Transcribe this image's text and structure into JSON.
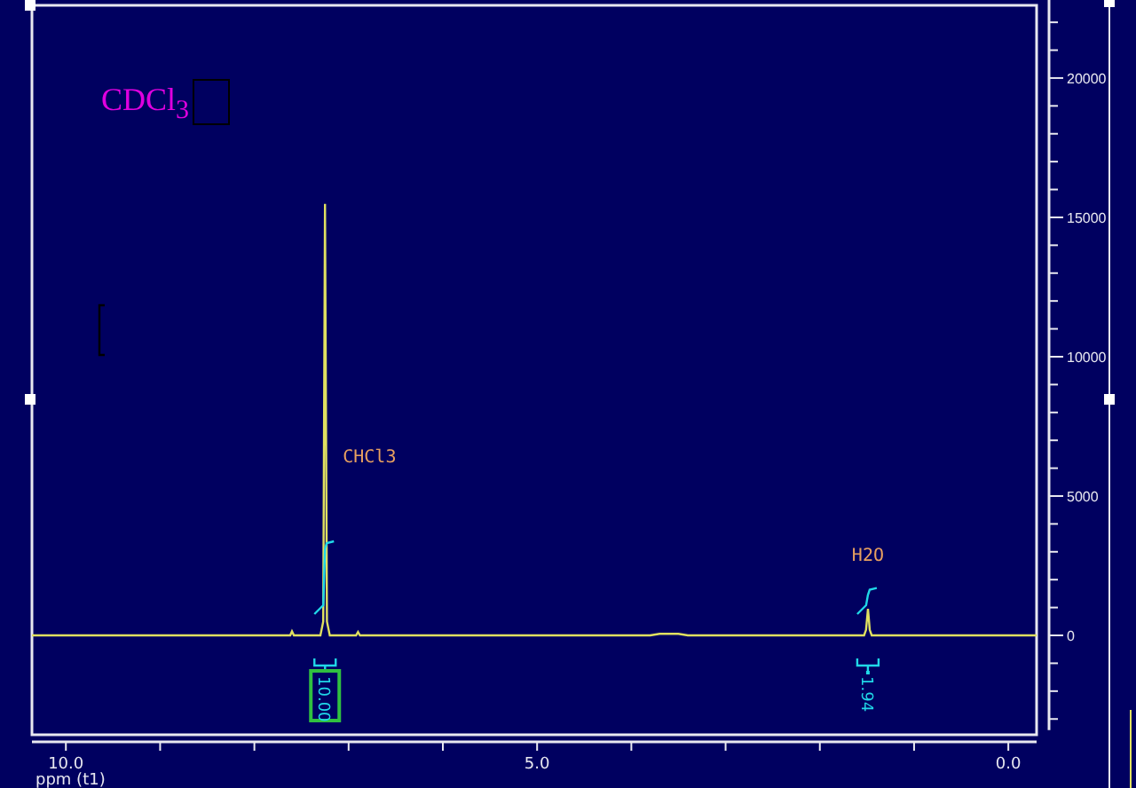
{
  "solvent_label": "CDCl$_{3}$",
  "spectrum": {
    "chart_data": {
      "type": "line",
      "xlabel": "ppm (t1)",
      "xlim": [
        10.36,
        -0.3
      ],
      "ylim": [
        -3400,
        22800
      ],
      "xticks": [
        {
          "value": 10,
          "label": "10.0"
        },
        {
          "value": 5,
          "label": "5.0"
        },
        {
          "value": 0,
          "label": "0.0"
        }
      ],
      "yticks": [
        0,
        5000,
        10000,
        15000,
        20000
      ],
      "series": [
        {
          "color": "#e0e060",
          "x": [
            10.36,
            7.62,
            7.6,
            7.58,
            7.3,
            7.27,
            7.25,
            7.23,
            7.2,
            6.92,
            6.9,
            6.88,
            3.8,
            3.7,
            3.5,
            3.4,
            1.53,
            1.51,
            1.49,
            1.47,
            1.45,
            -0.3
          ],
          "values": [
            0,
            0,
            150,
            0,
            0,
            500,
            15480,
            500,
            0,
            0,
            120,
            0,
            0,
            60,
            60,
            0,
            0,
            200,
            950,
            200,
            0,
            0
          ]
        }
      ],
      "annotations": [
        {
          "text": "CHCl3"
        },
        {
          "text": "H2O"
        }
      ]
    }
  },
  "integrals": [
    {
      "label": "10.00",
      "selected": true
    },
    {
      "label": "1.94",
      "selected": false
    }
  ]
}
